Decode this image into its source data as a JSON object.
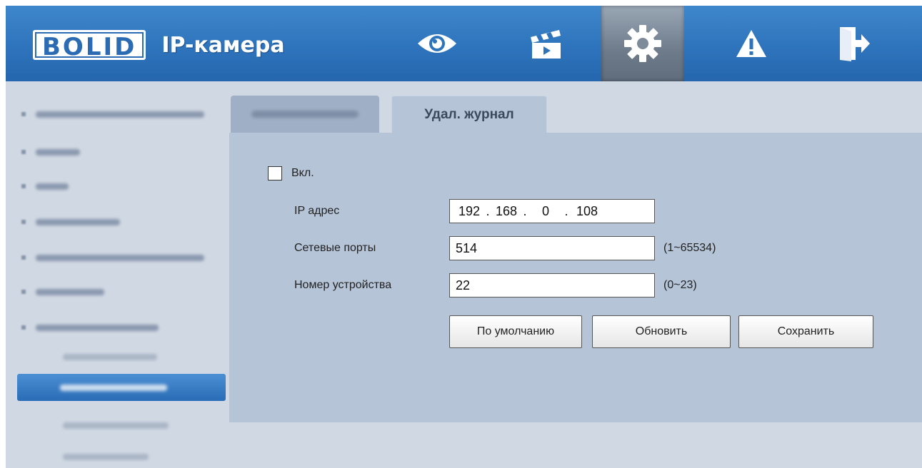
{
  "header": {
    "logo_text": "BOLID",
    "app_title": "IP-камера",
    "nav": [
      {
        "icon": "eye-icon",
        "active": false
      },
      {
        "icon": "clapperboard-icon",
        "active": false
      },
      {
        "icon": "gear-icon",
        "active": true
      },
      {
        "icon": "warning-icon",
        "active": false
      },
      {
        "icon": "exit-icon",
        "active": false
      }
    ],
    "colors": {
      "header_blue": "#2e74bc",
      "active_gray": "#6d7b8b"
    }
  },
  "sidebar": {
    "note": ""
  },
  "tabs": {
    "active_label": "Удал. журнал"
  },
  "form": {
    "enable_label": "Вкл.",
    "enabled": false,
    "ip_label": "IP адрес",
    "ip": [
      "192",
      "168",
      "0",
      "108"
    ],
    "ip_sep": ".",
    "port_label": "Сетевые порты",
    "port_value": "514",
    "port_hint": "(1~65534)",
    "device_label": "Номер устройства",
    "device_value": "22",
    "device_hint": "(0~23)"
  },
  "buttons": {
    "default": "По умолчанию",
    "refresh": "Обновить",
    "save": "Сохранить"
  }
}
